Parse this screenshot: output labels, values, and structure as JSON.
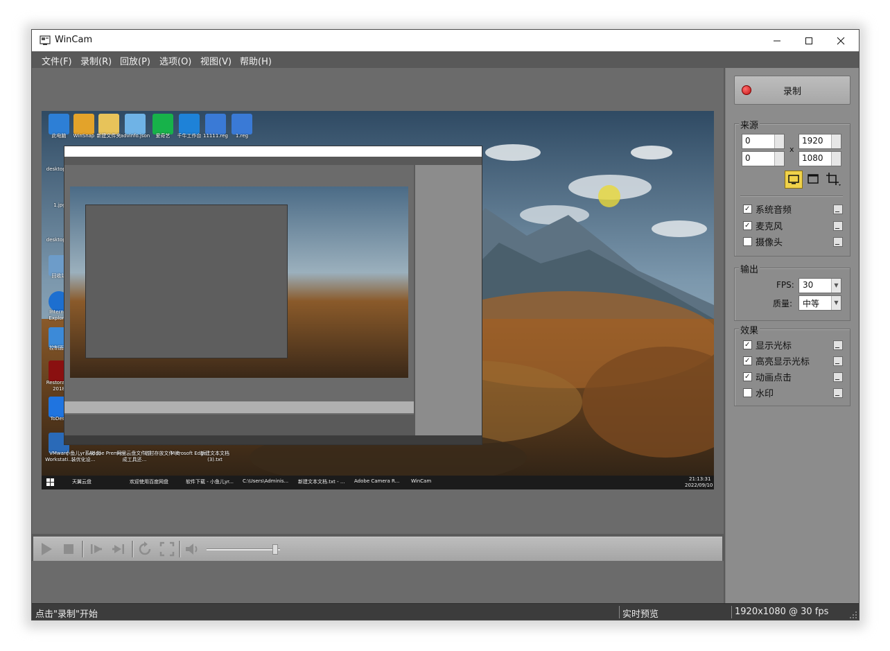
{
  "window": {
    "title": "WinCam",
    "controls": {
      "minimize": "minimize-icon",
      "maximize": "maximize-icon",
      "close": "close-icon"
    }
  },
  "menu": [
    "文件(F)",
    "录制(R)",
    "回放(P)",
    "选项(O)",
    "视图(V)",
    "帮助(H)"
  ],
  "record_button": {
    "label": "录制"
  },
  "source": {
    "label": "来源",
    "x": "0",
    "y": "0",
    "separator": "x",
    "width": "1920",
    "height": "1080",
    "mode_icons": [
      "monitor-icon",
      "window-icon",
      "crop-icon"
    ]
  },
  "audio": [
    {
      "label": "系统音频",
      "checked": true
    },
    {
      "label": "麦克风",
      "checked": true
    },
    {
      "label": "摄像头",
      "checked": false
    }
  ],
  "output": {
    "label": "输出",
    "fps_label": "FPS:",
    "fps_value": "30",
    "quality_label": "质量:",
    "quality_value": "中等"
  },
  "effects": {
    "label": "效果",
    "items": [
      {
        "label": "显示光标",
        "checked": true
      },
      {
        "label": "高亮显示光标",
        "checked": true
      },
      {
        "label": "动画点击",
        "checked": true
      },
      {
        "label": "水印",
        "checked": false
      }
    ]
  },
  "status": {
    "left": "点击\"录制\"开始",
    "middle": "实时预览",
    "right": "1920x1080 @ 30 fps"
  },
  "playback": {
    "volume_level": 0.97
  },
  "preview": {
    "desktop_icons": [
      {
        "label": "此电脑"
      },
      {
        "label": "WinSnap"
      },
      {
        "label": "新建文件夹"
      },
      {
        "label": "advinfo.json"
      },
      {
        "label": "爱奇艺"
      },
      {
        "label": "千牛工作台"
      },
      {
        "label": "11111.reg"
      },
      {
        "label": "1.reg"
      }
    ],
    "left_icons": [
      "desktop.ini",
      "1.jpg",
      "desktop.ini",
      "回收站",
      "Internet Explorer",
      "控制面板",
      "Restorator 2018",
      "ToDesk",
      "VMware Workstati..."
    ],
    "bottom_icons": [
      "小鱼儿yr系统 封装优化设...",
      "Adobe Premie...",
      "阿里云盘文件 生成工具还...",
      "临时存放文件 夹",
      "Microsoft Edge",
      "新建文本文档 (3).txt"
    ],
    "taskbar": [
      "天翼云盘",
      "欢迎使用百度网盘",
      "软件下载 - 小鱼儿yr...",
      "C:\\Users\\Adminis...",
      "新建文本文档.txt - ...",
      "Adobe Camera R...",
      "WinCam"
    ],
    "clock_time": "21:13:31",
    "clock_date": "2022/09/10"
  },
  "colors": {
    "window_bg": "#5a5a5a",
    "panel_bg": "#8c8c8c",
    "status_bg": "#3c3c3c",
    "record_red": "#d42020",
    "highlight_yellow": "#e8d83a"
  }
}
